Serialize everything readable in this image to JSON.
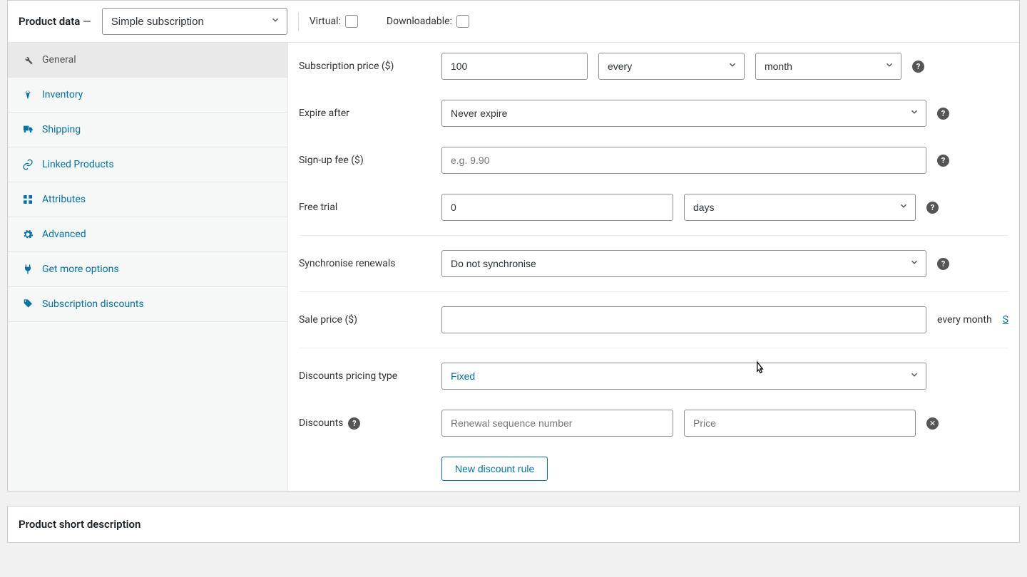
{
  "header": {
    "title": "Product data",
    "type_selected": "Simple subscription",
    "virtual_label": "Virtual:",
    "downloadable_label": "Downloadable:"
  },
  "tabs": [
    {
      "key": "general",
      "label": "General",
      "icon": "wrench",
      "active": true
    },
    {
      "key": "inventory",
      "label": "Inventory",
      "icon": "diamond",
      "active": false
    },
    {
      "key": "shipping",
      "label": "Shipping",
      "icon": "truck",
      "active": false
    },
    {
      "key": "linked",
      "label": "Linked Products",
      "icon": "link",
      "active": false
    },
    {
      "key": "attributes",
      "label": "Attributes",
      "icon": "grid",
      "active": false
    },
    {
      "key": "advanced",
      "label": "Advanced",
      "icon": "gear",
      "active": false
    },
    {
      "key": "more",
      "label": "Get more options",
      "icon": "plug",
      "active": false
    },
    {
      "key": "discounts",
      "label": "Subscription discounts",
      "icon": "tag",
      "active": false
    }
  ],
  "fields": {
    "sub_price_label": "Subscription price ($)",
    "sub_price_value": "100",
    "interval_selected": "every",
    "period_selected": "month",
    "expire_label": "Expire after",
    "expire_selected": "Never expire",
    "signup_label": "Sign-up fee ($)",
    "signup_placeholder": "e.g. 9.90",
    "trial_label": "Free trial",
    "trial_value": "0",
    "trial_unit_selected": "days",
    "sync_label": "Synchronise renewals",
    "sync_selected": "Do not synchronise",
    "sale_label": "Sale price ($)",
    "sale_after_text": "every month",
    "sale_link": "S",
    "dtype_label": "Discounts pricing type",
    "dtype_selected": "Fixed",
    "discounts_label": "Discounts",
    "renewal_placeholder": "Renewal sequence number",
    "dprice_placeholder": "Price",
    "new_rule_btn": "New discount rule"
  },
  "short_desc_title": "Product short description"
}
